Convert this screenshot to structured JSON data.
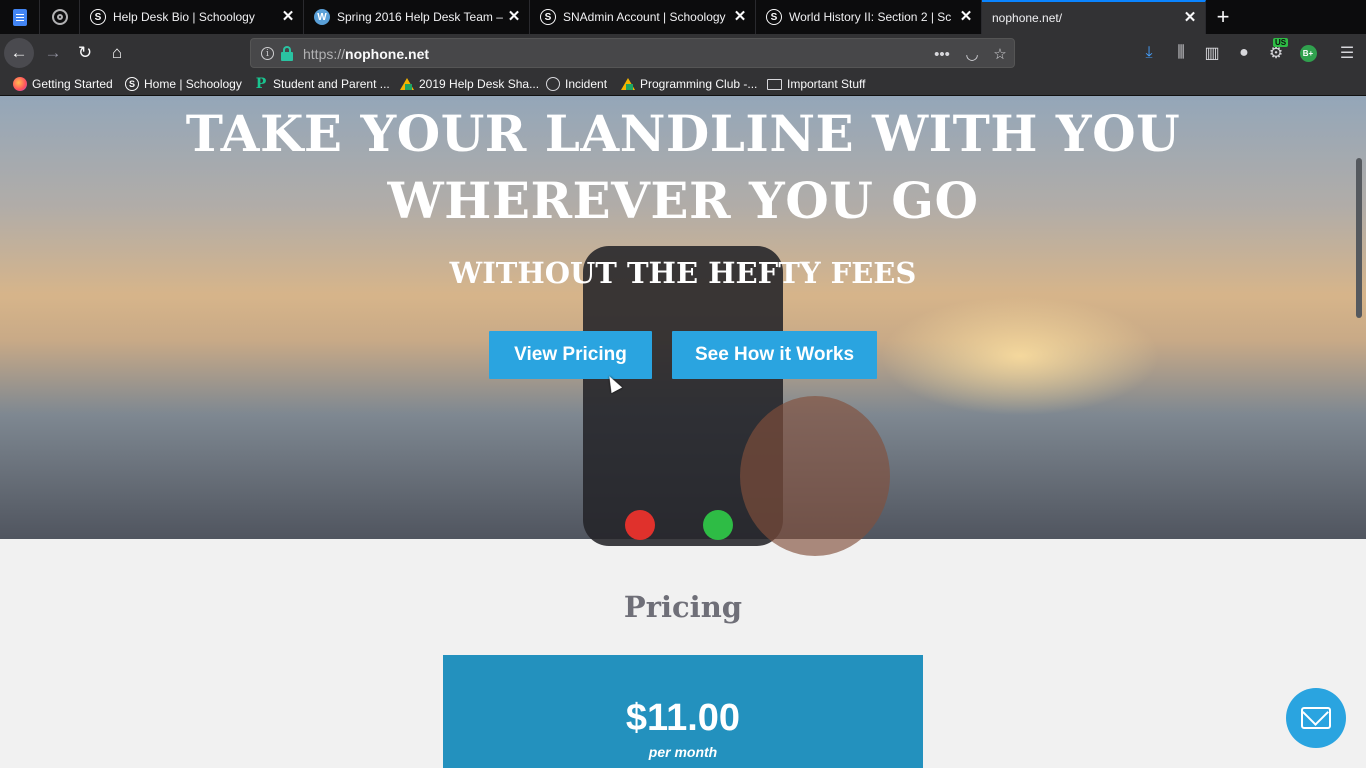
{
  "browser": {
    "tabs": [
      {
        "title": "Help Desk Bio | Schoology",
        "icon": "schoology-icon"
      },
      {
        "title": "Spring 2016 Help Desk Team –",
        "icon": "wordpress-icon"
      },
      {
        "title": "SNAdmin Account | Schoology",
        "icon": "schoology-icon"
      },
      {
        "title": "World History II: Section 2 | Sc",
        "icon": "schoology-icon"
      },
      {
        "title": "nophone.net/",
        "icon": "none",
        "active": true
      }
    ],
    "close_glyph": "✕",
    "new_tab_glyph": "+",
    "url_protocol": "https://",
    "url_host": "nophone.net",
    "extension_badge": "US",
    "grade_badge": "B+",
    "bookmarks": [
      {
        "label": "Getting Started",
        "icon": "firefox-icon"
      },
      {
        "label": "Home | Schoology",
        "icon": "schoology-icon"
      },
      {
        "label": "Student and Parent ...",
        "icon": "p-icon"
      },
      {
        "label": "2019 Help Desk Sha...",
        "icon": "drive-icon"
      },
      {
        "label": "Incident",
        "icon": "globe-icon"
      },
      {
        "label": "Programming Club -...",
        "icon": "drive-icon"
      },
      {
        "label": "Important Stuff",
        "icon": "folder-icon"
      }
    ]
  },
  "hero": {
    "headline": "TAKE YOUR LANDLINE WITH YOU WHEREVER YOU GO",
    "subheadline": "WITHOUT THE HEFTY FEES",
    "buttons": [
      "View Pricing",
      "See How it Works"
    ]
  },
  "pricing": {
    "title": "Pricing",
    "price": "$11.00",
    "period": "per month",
    "card_color": "#2391be"
  },
  "colors": {
    "accent": "#2aa4e0",
    "active_tab_line": "#0a84ff"
  }
}
